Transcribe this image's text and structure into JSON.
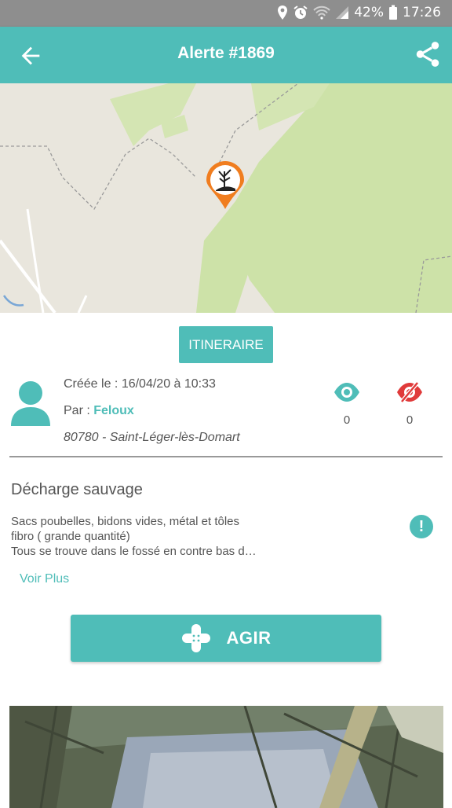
{
  "status_bar": {
    "battery": "42%",
    "time": "17:26",
    "icons": [
      "location-icon",
      "alarm-icon",
      "wifi-icon",
      "signal-icon",
      "battery-icon"
    ]
  },
  "app_bar": {
    "title": "Alerte #1869",
    "back_icon": "arrow-left-icon",
    "share_icon": "share-icon"
  },
  "map": {
    "marker_icon": "pollution-marker-icon"
  },
  "itinerary_button": "ITINERAIRE",
  "alert": {
    "created": "Créée le : 16/04/20 à 10:33",
    "author_prefix": "Par : ",
    "author_name": "Feloux",
    "location": "80780 - Saint-Léger-lès-Domart",
    "views_count": "0",
    "hidden_count": "0"
  },
  "description": {
    "title": "Décharge sauvage",
    "lines": [
      "Sacs poubelles, bidons vides, métal et tôles",
      "fibro ( grande quantité)",
      "Tous se trouve dans le fossé en contre bas d…"
    ],
    "more": "Voir Plus"
  },
  "action_button": "AGIR",
  "colors": {
    "accent": "#4fbdb8",
    "danger": "#e03a3a",
    "marker": "#f07d1f"
  }
}
